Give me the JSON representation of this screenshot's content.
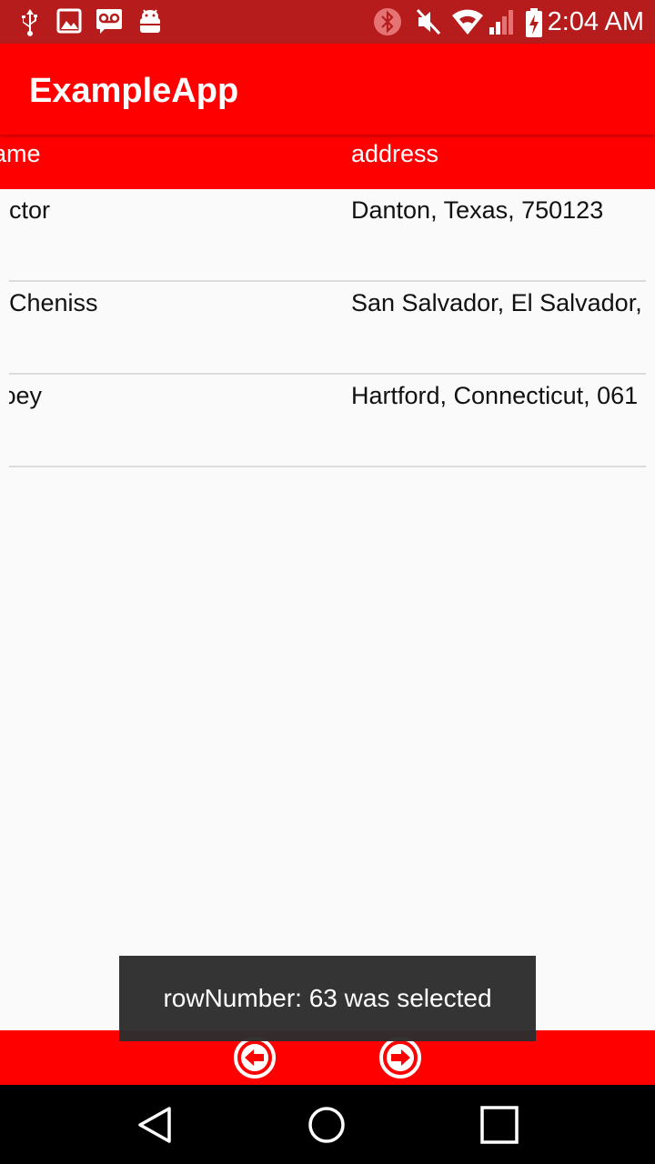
{
  "status_bar": {
    "time": "2:04 AM",
    "icons": [
      "usb-icon",
      "image-icon",
      "voicemail-icon",
      "android-debug-icon",
      "bluetooth-icon",
      "mute-icon",
      "wifi-icon",
      "signal-icon",
      "battery-charging-icon"
    ]
  },
  "app_bar": {
    "title": "ExampleApp"
  },
  "table": {
    "columns": [
      "ame",
      "address"
    ],
    "rows": [
      {
        "name": "ctor",
        "address": "Danton, Texas, 750123"
      },
      {
        "name": "Cheniss",
        "address": "San Salvador, El Salvador,"
      },
      {
        "name": "ɔey",
        "address": "Hartford, Connecticut, 061"
      }
    ]
  },
  "toast": {
    "message": "rowNumber: 63 was selected"
  },
  "bottom_bar": {
    "icons": [
      "prev-page-icon",
      "next-page-icon"
    ]
  },
  "nav_bar": {
    "icons": [
      "back-icon",
      "home-icon",
      "recents-icon"
    ]
  },
  "colors": {
    "primary": "#ff0000",
    "status_bar": "#b71c1c",
    "toast_bg": "#2d2d2d"
  }
}
